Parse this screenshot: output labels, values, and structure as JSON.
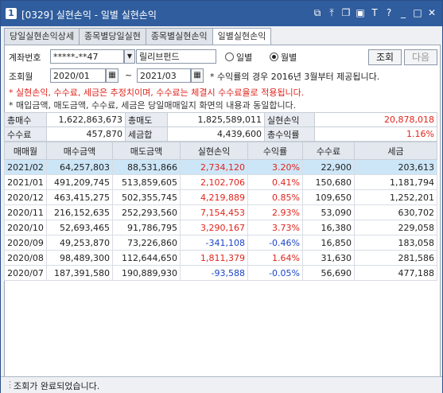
{
  "title": {
    "num": "1",
    "text": "[0329] 실현손익 - 일별 실현손익"
  },
  "title_icons": [
    "link-icon",
    "pin-icon",
    "copy-icon",
    "dock-icon",
    "text-icon",
    "help-icon",
    "minimize-icon",
    "maximize-icon",
    "close-icon"
  ],
  "tabs": [
    "당일실현손익상세",
    "종목별당일실현",
    "종목별실현손익",
    "일별실현손익"
  ],
  "form": {
    "account_label": "계좌번호",
    "account_value": "*****-**47",
    "account_name": "릴리브펀드",
    "radio_daily": "일별",
    "radio_monthly": "월별",
    "inquiry_btn": "조회",
    "next_btn": "다음",
    "period_label": "조회월",
    "from": "2020/01",
    "to": "2021/03",
    "tilde": "~",
    "period_note": "* 수익률의 경우 2016년 3월부터 제공됩니다."
  },
  "notes": {
    "red": "* 실현손익, 수수료, 세금은 추정치이며, 수수료는 체결시 수수료율로 적용됩니다.",
    "dark": "* 매입금액, 매도금액, 수수료, 세금은 당일매매일지 화면의 내용과 동일합니다."
  },
  "summary": {
    "total_buy_label": "총매수",
    "total_buy": "1,622,863,673",
    "total_sell_label": "총매도",
    "total_sell": "1,825,589,011",
    "realized_label": "실현손익",
    "realized": "20,878,018",
    "fee_label": "수수료",
    "fee": "457,870",
    "tax_label": "세금합",
    "tax": "4,439,600",
    "total_return_label": "총수익률",
    "total_return": "1.16%"
  },
  "grid": {
    "headers": [
      "매매월",
      "매수금액",
      "매도금액",
      "실현손익",
      "수익률",
      "수수료",
      "세금"
    ],
    "rows": [
      [
        "2021/02",
        "64,257,803",
        "88,531,866",
        "2,734,120",
        "3.20%",
        "22,900",
        "203,613"
      ],
      [
        "2021/01",
        "491,209,745",
        "513,859,605",
        "2,102,706",
        "0.41%",
        "150,680",
        "1,181,794"
      ],
      [
        "2020/12",
        "463,415,275",
        "502,355,745",
        "4,219,889",
        "0.85%",
        "109,650",
        "1,252,201"
      ],
      [
        "2020/11",
        "216,152,635",
        "252,293,560",
        "7,154,453",
        "2.93%",
        "53,090",
        "630,702"
      ],
      [
        "2020/10",
        "52,693,465",
        "91,786,795",
        "3,290,167",
        "3.73%",
        "16,380",
        "229,058"
      ],
      [
        "2020/09",
        "49,253,870",
        "73,226,860",
        "-341,108",
        "-0.46%",
        "16,850",
        "183,058"
      ],
      [
        "2020/08",
        "98,489,300",
        "112,644,650",
        "1,811,379",
        "1.64%",
        "31,630",
        "281,586"
      ],
      [
        "2020/07",
        "187,391,580",
        "190,889,930",
        "-93,588",
        "-0.05%",
        "56,690",
        "477,188"
      ]
    ]
  },
  "status": "조회가 완료되었습니다."
}
